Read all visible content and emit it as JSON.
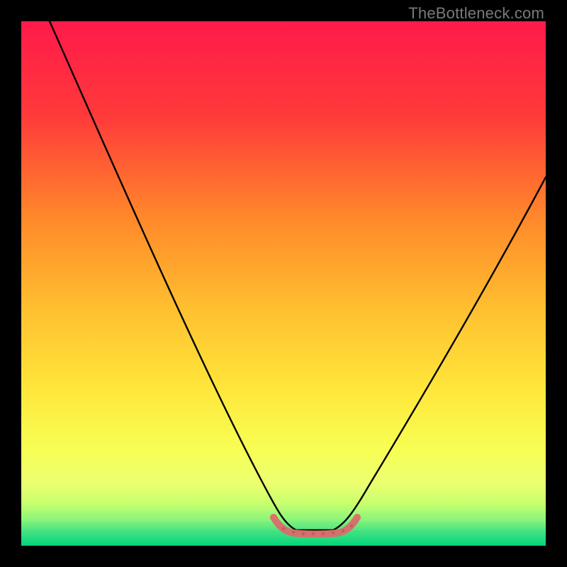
{
  "watermark": "TheBottleneck.com",
  "chart_data": {
    "type": "line",
    "title": "",
    "xlabel": "",
    "ylabel": "",
    "xlim": [
      0,
      100
    ],
    "ylim": [
      0,
      100
    ],
    "grid": false,
    "legend": false,
    "background_gradient": {
      "top": "#ff1a4a",
      "mid_upper": "#ff8a2a",
      "mid": "#ffe63a",
      "mid_lower": "#f5ff66",
      "band": "#c7ff6e",
      "bottom": "#00d67a"
    },
    "series": [
      {
        "name": "main-curve",
        "color": "#000000",
        "x": [
          5,
          10,
          20,
          30,
          40,
          47,
          50,
          53,
          56,
          60,
          64,
          72,
          80,
          90,
          100
        ],
        "y": [
          100,
          90,
          70,
          50,
          30,
          12,
          6,
          2,
          2,
          2,
          6,
          18,
          32,
          52,
          72
        ]
      },
      {
        "name": "bottom-marker",
        "color": "#e06a6a",
        "style": "marker-strip",
        "x": [
          49,
          50,
          51,
          52,
          53,
          54,
          55,
          56,
          57,
          58,
          59,
          60,
          61,
          62,
          63
        ],
        "y": [
          4,
          3,
          2.5,
          2,
          2,
          2,
          2,
          2,
          2,
          2,
          2,
          2,
          2.5,
          3,
          4
        ]
      }
    ]
  }
}
